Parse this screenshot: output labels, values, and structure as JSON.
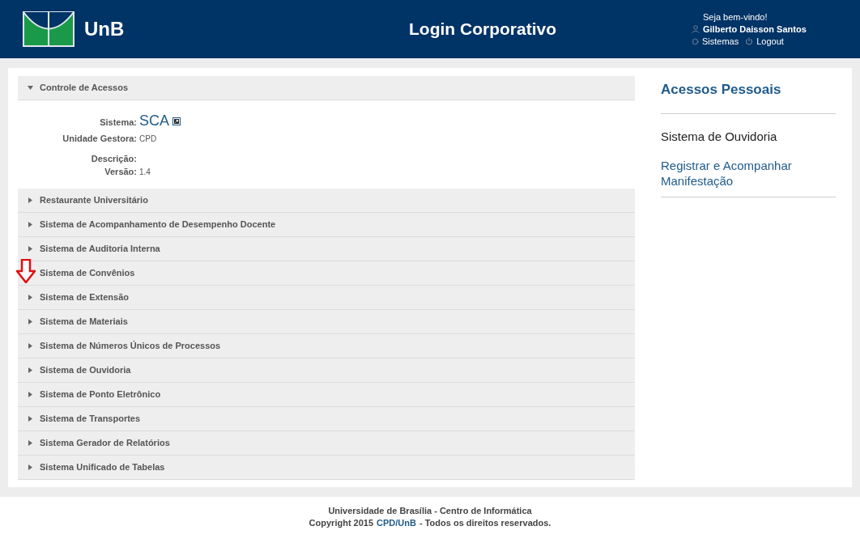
{
  "header": {
    "logo_text": "UnB",
    "title": "Login Corporativo",
    "greeting": "Seja bem-vindo!",
    "user_name": "Gilberto Daisson Santos",
    "links": [
      {
        "label": "Sistemas",
        "kind": "gear"
      },
      {
        "label": "Logout",
        "kind": "power"
      }
    ]
  },
  "sections": [
    {
      "title": "Controle de Acessos",
      "expanded": true,
      "details": [
        {
          "label": "Sistema:",
          "value": "SCA",
          "kind": "link"
        },
        {
          "label": "Unidade Gestora:",
          "value": "CPD",
          "kind": "text"
        },
        {
          "label": "Descrição:"
        },
        {
          "label": "Versão:",
          "value": "1.4",
          "kind": "text"
        }
      ]
    },
    {
      "title": "Restaurante Universitário",
      "expanded": false
    },
    {
      "title": "Sistema de Acompanhamento de Desempenho Docente",
      "expanded": false
    },
    {
      "title": "Sistema de Auditoria Interna",
      "expanded": false
    },
    {
      "title": "Sistema de Convênios",
      "expanded": false
    },
    {
      "title": "Sistema de Extensão",
      "expanded": false
    },
    {
      "title": "Sistema de Materiais",
      "expanded": false
    },
    {
      "title": "Sistema de Números Únicos de Processos",
      "expanded": false
    },
    {
      "title": "Sistema de Ouvidoria",
      "expanded": false
    },
    {
      "title": "Sistema de Ponto Eletrônico",
      "expanded": false
    },
    {
      "title": "Sistema de Transportes",
      "expanded": false
    },
    {
      "title": "Sistema Gerador de Relatórios",
      "expanded": false
    },
    {
      "title": "Sistema Unificado de Tabelas",
      "expanded": false
    }
  ],
  "sidebar": {
    "title": "Acessos Pessoais",
    "groups": [
      {
        "heading": "Sistema de Ouvidoria",
        "links": [
          "Registrar e Acompanhar Manifestação"
        ]
      }
    ]
  },
  "footer": {
    "line1": "Universidade de Brasília - Centro de Informática",
    "line2_before": "Copyright 2015",
    "line2_link": "CPD/UnB",
    "line2_after": "- Todos os direitos reservados."
  }
}
